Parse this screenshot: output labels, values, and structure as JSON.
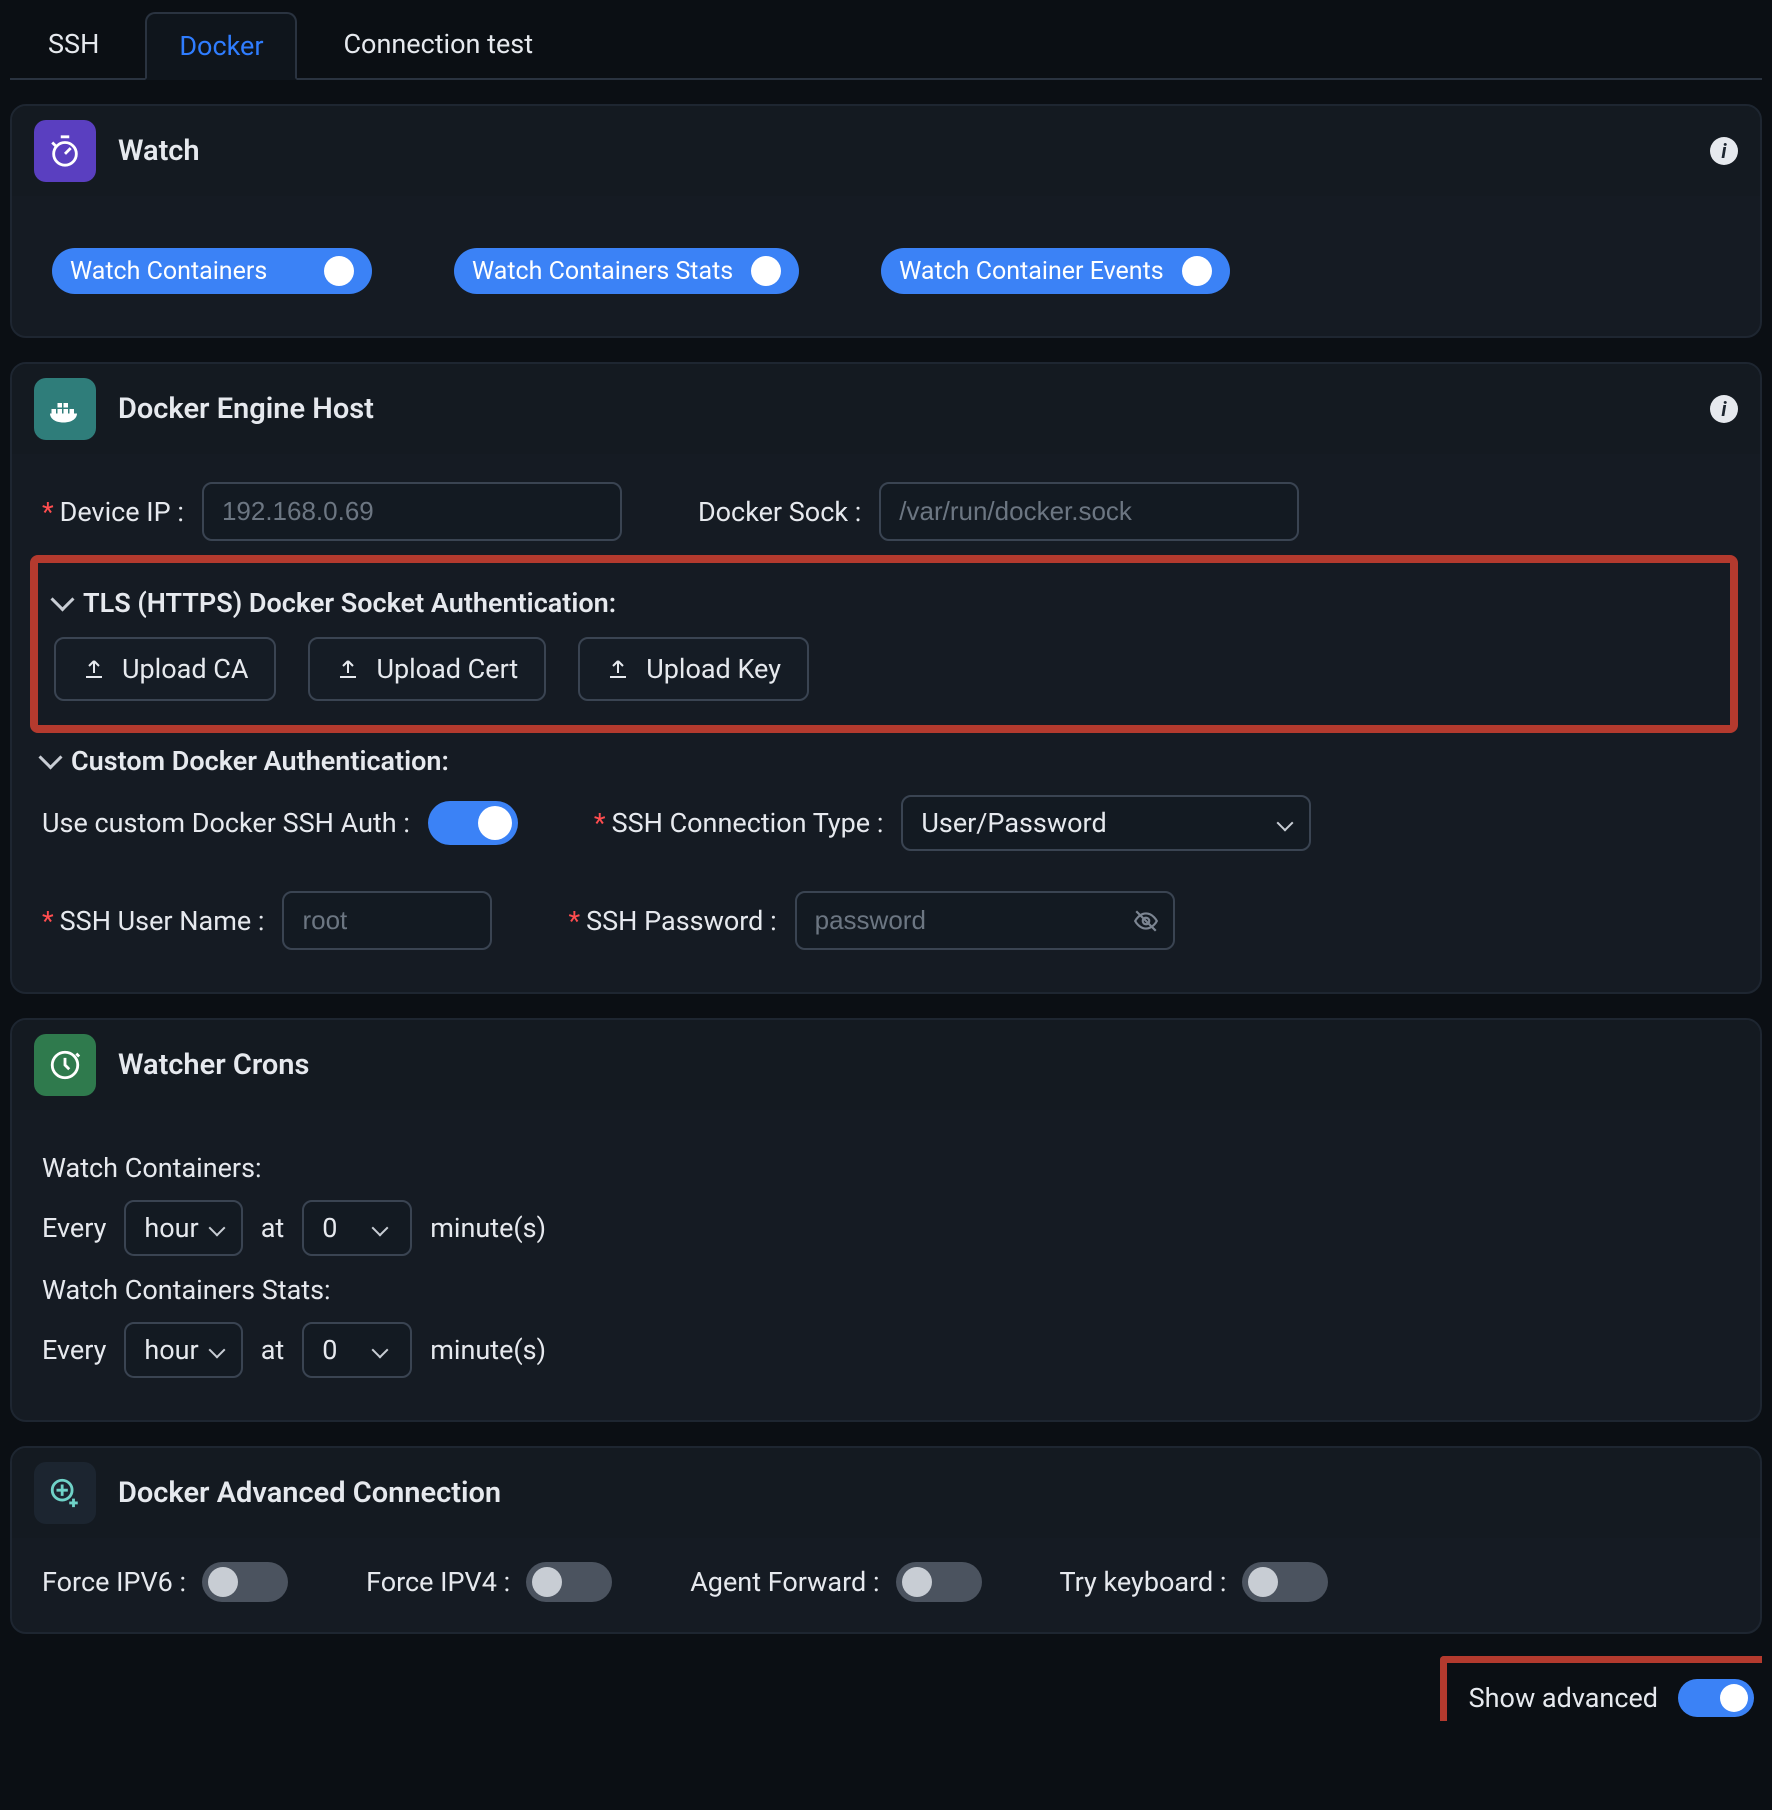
{
  "tabs": {
    "ssh": "SSH",
    "docker": "Docker",
    "conn": "Connection test"
  },
  "watch": {
    "title": "Watch",
    "containers": "Watch Containers",
    "stats": "Watch Containers Stats",
    "events": "Watch Container Events"
  },
  "engine": {
    "title": "Docker Engine Host",
    "device_ip_label": "Device IP",
    "device_ip_placeholder": "192.168.0.69",
    "sock_label": "Docker Sock",
    "sock_placeholder": "/var/run/docker.sock",
    "tls_title": "TLS (HTTPS) Docker Socket Authentication:",
    "upload_ca": "Upload CA",
    "upload_cert": "Upload Cert",
    "upload_key": "Upload Key",
    "custom_title": "Custom Docker Authentication:",
    "use_custom": "Use custom Docker SSH Auth",
    "ssh_type_label": "SSH Connection Type",
    "ssh_type_value": "User/Password",
    "ssh_user_label": "SSH User Name",
    "ssh_user_placeholder": "root",
    "ssh_pwd_label": "SSH Password",
    "ssh_pwd_placeholder": "password"
  },
  "crons": {
    "title": "Watcher Crons",
    "wc_label": "Watch Containers:",
    "wcs_label": "Watch Containers Stats:",
    "every": "Every",
    "hour": "hour",
    "at": "at",
    "zero": "0",
    "minutes": "minute(s)"
  },
  "adv": {
    "title": "Docker Advanced Connection",
    "ipv6": "Force IPV6",
    "ipv4": "Force IPV4",
    "fwd": "Agent Forward",
    "kb": "Try keyboard"
  },
  "footer": {
    "show": "Show advanced"
  }
}
